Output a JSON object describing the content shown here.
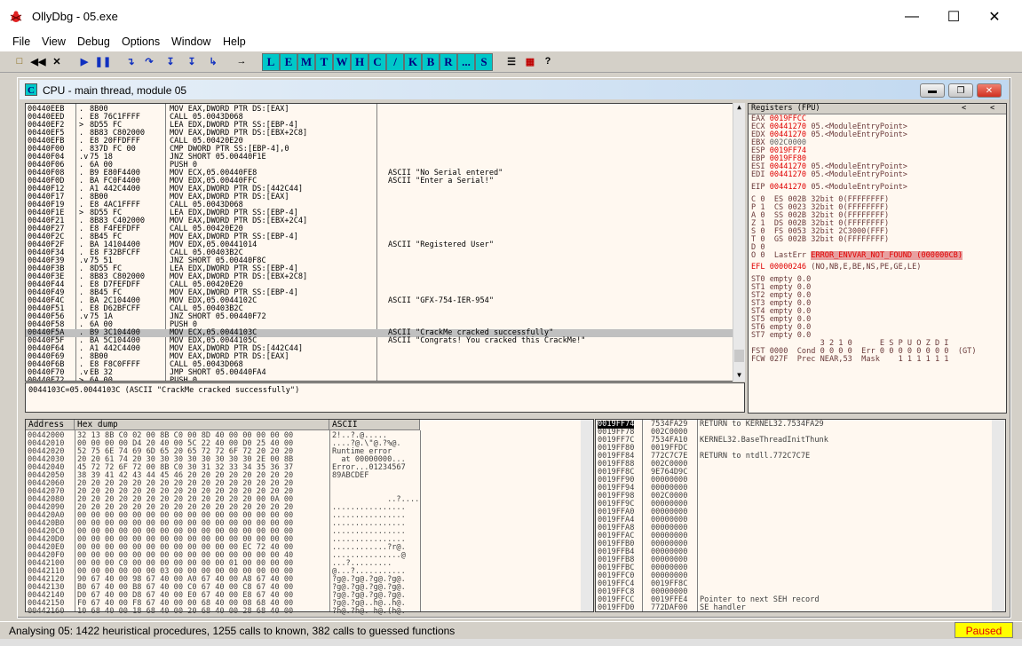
{
  "window": {
    "title": "OllyDbg - 05.exe"
  },
  "menu": [
    "File",
    "View",
    "Debug",
    "Options",
    "Window",
    "Help"
  ],
  "toolbar_letters": [
    "L",
    "E",
    "M",
    "T",
    "W",
    "H",
    "C",
    "/",
    "K",
    "B",
    "R",
    "...",
    "S"
  ],
  "cpu": {
    "title": "CPU - main thread, module 05",
    "icon_letter": "C"
  },
  "disasm": [
    [
      "00440EEB",
      ".",
      "8B00",
      "MOV EAX,DWORD PTR DS:[EAX]",
      ""
    ],
    [
      "00440EED",
      ".",
      "E8 76C1FFFF",
      "CALL 05.0043D068",
      ""
    ],
    [
      "00440EF2",
      ">",
      "8D55 FC",
      "LEA EDX,DWORD PTR SS:[EBP-4]",
      ""
    ],
    [
      "00440EF5",
      ".",
      "8B83 C802000",
      "MOV EAX,DWORD PTR DS:[EBX+2C8]",
      ""
    ],
    [
      "00440EFB",
      ".",
      "E8 20FFDFFF",
      "CALL 05.00420E20",
      ""
    ],
    [
      "00440F00",
      ".",
      "837D FC 00",
      "CMP DWORD PTR SS:[EBP-4],0",
      ""
    ],
    [
      "00440F04",
      ".v",
      "75 18",
      "JNZ SHORT 05.00440F1E",
      ""
    ],
    [
      "00440F06",
      ".",
      "6A 00",
      "PUSH 0",
      ""
    ],
    [
      "00440F08",
      ".",
      "B9 E80F4400",
      "MOV ECX,05.00440FE8",
      "ASCII \"No Serial entered\""
    ],
    [
      "00440F0D",
      ".",
      "BA FC0F4400",
      "MOV EDX,05.00440FFC",
      "ASCII \"Enter a Serial!\""
    ],
    [
      "00440F12",
      ".",
      "A1 442C4400",
      "MOV EAX,DWORD PTR DS:[442C44]",
      ""
    ],
    [
      "00440F17",
      ".",
      "8B00",
      "MOV EAX,DWORD PTR DS:[EAX]",
      ""
    ],
    [
      "00440F19",
      ".",
      "E8 4AC1FFFF",
      "CALL 05.0043D068",
      ""
    ],
    [
      "00440F1E",
      ">",
      "8D55 FC",
      "LEA EDX,DWORD PTR SS:[EBP-4]",
      ""
    ],
    [
      "00440F21",
      ".",
      "8B83 C402000",
      "MOV EAX,DWORD PTR DS:[EBX+2C4]",
      ""
    ],
    [
      "00440F27",
      ".",
      "E8 F4FEFDFF",
      "CALL 05.00420E20",
      ""
    ],
    [
      "00440F2C",
      ".",
      "8B45 FC",
      "MOV EAX,DWORD PTR SS:[EBP-4]",
      ""
    ],
    [
      "00440F2F",
      ".",
      "BA 14104400",
      "MOV EDX,05.00441014",
      "ASCII \"Registered User\""
    ],
    [
      "00440F34",
      ".",
      "E8 F32BFCFF",
      "CALL 05.00403B2C",
      ""
    ],
    [
      "00440F39",
      ".v",
      "75 51",
      "JNZ SHORT 05.00440F8C",
      ""
    ],
    [
      "00440F3B",
      ".",
      "8D55 FC",
      "LEA EDX,DWORD PTR SS:[EBP-4]",
      ""
    ],
    [
      "00440F3E",
      ".",
      "8B83 C802000",
      "MOV EAX,DWORD PTR DS:[EBX+2C8]",
      ""
    ],
    [
      "00440F44",
      ".",
      "E8 D7FEFDFF",
      "CALL 05.00420E20",
      ""
    ],
    [
      "00440F49",
      ".",
      "8B45 FC",
      "MOV EAX,DWORD PTR SS:[EBP-4]",
      ""
    ],
    [
      "00440F4C",
      ".",
      "BA 2C104400",
      "MOV EDX,05.0044102C",
      "ASCII \"GFX-754-IER-954\""
    ],
    [
      "00440F51",
      ".",
      "E8 D62BFCFF",
      "CALL 05.00403B2C",
      ""
    ],
    [
      "00440F56",
      ".v",
      "75 1A",
      "JNZ SHORT 05.00440F72",
      ""
    ],
    [
      "00440F58",
      ".",
      "6A 00",
      "PUSH 0",
      ""
    ],
    [
      "00440F5A",
      ".",
      "B9 3C104400",
      "MOV ECX,05.0044103C",
      "ASCII \"CrackMe cracked successfully\""
    ],
    [
      "00440F5F",
      ".",
      "BA 5C104400",
      "MOV EDX,05.0044105C",
      "ASCII \"Congrats! You cracked this CrackMe!\""
    ],
    [
      "00440F64",
      ".",
      "A1 442C4400",
      "MOV EAX,DWORD PTR DS:[442C44]",
      ""
    ],
    [
      "00440F69",
      ".",
      "8B00",
      "MOV EAX,DWORD PTR DS:[EAX]",
      ""
    ],
    [
      "00440F6B",
      ".",
      "E8 F8C0FFFF",
      "CALL 05.0043D068",
      ""
    ],
    [
      "00440F70",
      ".v",
      "EB 32",
      "JMP SHORT 05.00440FA4",
      ""
    ],
    [
      "00440F72",
      ">",
      "6A 00",
      "PUSH 0",
      ""
    ]
  ],
  "info_line": "0044103C=05.0044103C (ASCII \"CrackMe cracked successfully\")",
  "registers": {
    "header": "Registers (FPU)",
    "lines": [
      [
        "EAX",
        "0019FFCC",
        "",
        true
      ],
      [
        "ECX",
        "00441270",
        "05.<ModuleEntryPoint>",
        true
      ],
      [
        "EDX",
        "00441270",
        "05.<ModuleEntryPoint>",
        true
      ],
      [
        "EBX",
        "002C0000",
        "",
        false
      ],
      [
        "ESP",
        "0019FF74",
        "",
        true
      ],
      [
        "EBP",
        "0019FF80",
        "",
        true
      ],
      [
        "ESI",
        "00441270",
        "05.<ModuleEntryPoint>",
        true
      ],
      [
        "EDI",
        "00441270",
        "05.<ModuleEntryPoint>",
        true
      ],
      [
        "",
        "",
        "",
        false
      ],
      [
        "EIP",
        "00441270",
        "05.<ModuleEntryPoint>",
        true
      ]
    ],
    "flags": [
      "C 0  ES 002B 32bit 0(FFFFFFFF)",
      "P 1  CS 0023 32bit 0(FFFFFFFF)",
      "A 0  SS 002B 32bit 0(FFFFFFFF)",
      "Z 1  DS 002B 32bit 0(FFFFFFFF)",
      "S 0  FS 0053 32bit 2C3000(FFF)",
      "T 0  GS 002B 32bit 0(FFFFFFFF)",
      "D 0",
      "O 0  LastErr "
    ],
    "lasterr": "ERROR_ENVVAR_NOT_FOUND (000000CB)",
    "efl": "EFL 00000246",
    "efl_flags": " (NO,NB,E,BE,NS,PE,GE,LE)",
    "fpu": [
      "ST0 empty 0.0",
      "ST1 empty 0.0",
      "ST2 empty 0.0",
      "ST3 empty 0.0",
      "ST4 empty 0.0",
      "ST5 empty 0.0",
      "ST6 empty 0.0",
      "ST7 empty 0.0"
    ],
    "fpu_tail": [
      "               3 2 1 0      E S P U O Z D I",
      "FST 0000  Cond 0 0 0 0  Err 0 0 0 0 0 0 0 0  (GT)",
      "FCW 027F  Prec NEAR,53  Mask    1 1 1 1 1 1"
    ]
  },
  "hexdump": {
    "headers": [
      "Address",
      "Hex dump",
      "ASCII"
    ],
    "rows": [
      [
        "00442000",
        "32 13 8B C0 02 00 8B C0 00 8D 40 00 00 00 00 00",
        "2!..?.@....."
      ],
      [
        "00442010",
        "00 00 00 00 D4 20 40 00 5C 22 40 00 D0 25 40 00",
        "....?@.\\\"@.?%@."
      ],
      [
        "00442020",
        "52 75 6E 74 69 6D 65 20 65 72 72 6F 72 20 20 20",
        "Runtime error   "
      ],
      [
        "00442030",
        "20 20 61 74 20 30 30 30 30 30 30 30 30 2E 00 8B",
        "  at 00000000..."
      ],
      [
        "00442040",
        "45 72 72 6F 72 00 8B C0 30 31 32 33 34 35 36 37",
        "Error...01234567"
      ],
      [
        "00442050",
        "38 39 41 42 43 44 45 46 20 20 20 20 20 20 20 20",
        "89ABCDEF"
      ],
      [
        "00442060",
        "20 20 20 20 20 20 20 20 20 20 20 20 20 20 20 20",
        ""
      ],
      [
        "00442070",
        "20 20 20 20 20 20 20 20 20 20 20 20 20 20 20 20",
        ""
      ],
      [
        "00442080",
        "20 20 20 20 20 20 20 20 20 20 20 20 20 00 0A 00",
        "            ..?...."
      ],
      [
        "00442090",
        "20 20 20 20 20 20 20 20 20 20 20 20 20 20 20 20",
        "................"
      ],
      [
        "004420A0",
        "00 00 00 00 00 00 00 00 00 00 00 00 00 00 00 00",
        "................"
      ],
      [
        "004420B0",
        "00 00 00 00 00 00 00 00 00 00 00 00 00 00 00 00",
        "................"
      ],
      [
        "004420C0",
        "00 00 00 00 00 00 00 00 00 00 00 00 00 00 00 00",
        "................"
      ],
      [
        "004420D0",
        "00 00 00 00 00 00 00 00 00 00 00 00 00 00 00 00",
        "................"
      ],
      [
        "004420E0",
        "00 00 00 00 00 00 00 00 00 00 00 00 EC 72 40 00",
        "............?r@."
      ],
      [
        "004420F0",
        "00 00 00 00 00 00 00 00 00 00 00 00 00 00 00 40",
        "...............@"
      ],
      [
        "00442100",
        "00 00 00 C0 00 00 00 00 00 00 00 01 00 00 00 00",
        "...?........."
      ],
      [
        "00442110",
        "00 00 00 00 00 00 03 00 00 00 00 00 00 00 00 00",
        "@...?..........."
      ],
      [
        "00442120",
        "90 67 40 00 98 67 40 00 A0 67 40 00 A8 67 40 00",
        "?g@.?g@.?g@.?g@."
      ],
      [
        "00442130",
        "B0 67 40 00 B8 67 40 00 C0 67 40 00 C8 67 40 00",
        "?g@.?g@.?g@.?g@."
      ],
      [
        "00442140",
        "D0 67 40 00 D8 67 40 00 E0 67 40 00 E8 67 40 00",
        "?g@.?g@.?g@.?g@."
      ],
      [
        "00442150",
        "F0 67 40 00 F8 67 40 00 00 68 40 00 08 68 40 00",
        "?g@.?g@..h@..h@."
      ],
      [
        "00442160",
        "10 68 40 00 18 68 40 00 20 68 40 00 28 68 40 00",
        "?h@.?h@. h@.(h@."
      ]
    ]
  },
  "stack": [
    [
      "0019FF74",
      "7534FA29",
      "RETURN to KERNEL32.7534FA29",
      true
    ],
    [
      "0019FF78",
      "002C0000",
      "",
      false
    ],
    [
      "0019FF7C",
      "7534FA10",
      "KERNEL32.BaseThreadInitThunk",
      false
    ],
    [
      "0019FF80",
      "0019FFDC",
      "",
      false
    ],
    [
      "0019FF84",
      "772C7C7E",
      "RETURN to ntdll.772C7C7E",
      false
    ],
    [
      "0019FF88",
      "002C0000",
      "",
      false
    ],
    [
      "0019FF8C",
      "9E764D9C",
      "",
      false
    ],
    [
      "0019FF90",
      "00000000",
      "",
      false
    ],
    [
      "0019FF94",
      "00000000",
      "",
      false
    ],
    [
      "0019FF98",
      "002C0000",
      "",
      false
    ],
    [
      "0019FF9C",
      "00000000",
      "",
      false
    ],
    [
      "0019FFA0",
      "00000000",
      "",
      false
    ],
    [
      "0019FFA4",
      "00000000",
      "",
      false
    ],
    [
      "0019FFA8",
      "00000000",
      "",
      false
    ],
    [
      "0019FFAC",
      "00000000",
      "",
      false
    ],
    [
      "0019FFB0",
      "00000000",
      "",
      false
    ],
    [
      "0019FFB4",
      "00000000",
      "",
      false
    ],
    [
      "0019FFB8",
      "00000000",
      "",
      false
    ],
    [
      "0019FFBC",
      "00000000",
      "",
      false
    ],
    [
      "0019FFC0",
      "00000000",
      "",
      false
    ],
    [
      "0019FFC4",
      "0019FF8C",
      "",
      false
    ],
    [
      "0019FFC8",
      "00000000",
      "",
      false
    ],
    [
      "0019FFCC",
      "0019FFE4",
      "Pointer to next SEH record",
      false
    ],
    [
      "0019FFD0",
      "772DAF00",
      "SE handler",
      false
    ]
  ],
  "status": {
    "text": "Analysing 05: 1422 heuristical procedures, 1255 calls to known, 382 calls to guessed functions",
    "state": "Paused"
  }
}
